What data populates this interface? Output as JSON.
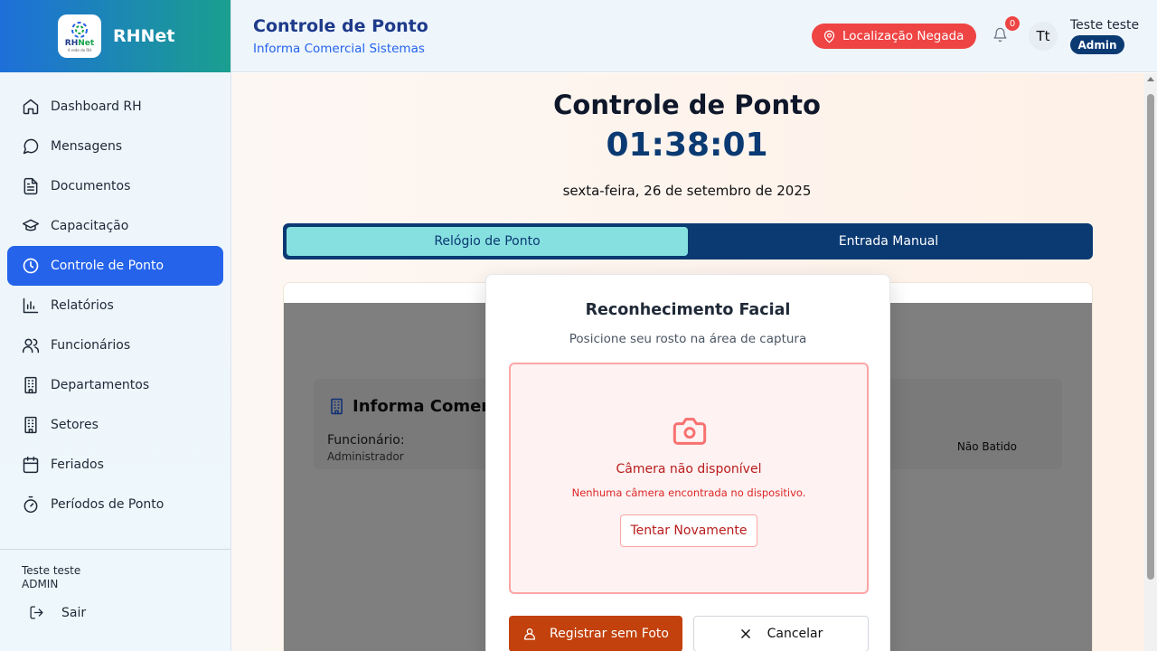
{
  "app": {
    "name": "RHNet",
    "logo_text_a": "RH",
    "logo_text_b": "Net",
    "logo_tagline": "A rede do RH"
  },
  "sidebar": {
    "items": [
      {
        "label": "Dashboard RH",
        "icon": "home-icon"
      },
      {
        "label": "Mensagens",
        "icon": "chat-icon"
      },
      {
        "label": "Documentos",
        "icon": "document-icon"
      },
      {
        "label": "Capacitação",
        "icon": "graduation-cap-icon"
      },
      {
        "label": "Controle de Ponto",
        "icon": "clock-icon",
        "active": true
      },
      {
        "label": "Relatórios",
        "icon": "bar-chart-icon"
      },
      {
        "label": "Funcionários",
        "icon": "users-icon"
      },
      {
        "label": "Departamentos",
        "icon": "building-icon"
      },
      {
        "label": "Setores",
        "icon": "building-icon"
      },
      {
        "label": "Feriados",
        "icon": "calendar-icon"
      },
      {
        "label": "Períodos de Ponto",
        "icon": "timer-icon"
      }
    ],
    "footer": {
      "user_name": "Teste teste",
      "user_role": "ADMIN",
      "logout_label": "Sair"
    }
  },
  "header": {
    "title": "Controle de Ponto",
    "subtitle": "Informa Comercial Sistemas",
    "location_badge": "Localização Negada",
    "notification_count": "0",
    "avatar_initials": "Tt",
    "user_name": "Teste teste",
    "user_role": "Admin"
  },
  "main": {
    "title": "Controle de Ponto",
    "time": "01:38:01",
    "date": "sexta-feira, 26 de setembro de 2025",
    "tabs": [
      {
        "label": "Relógio de Ponto",
        "active": true
      },
      {
        "label": "Entrada Manual",
        "active": false
      }
    ],
    "info_card": {
      "company": "Informa Comercial Sistemas",
      "employee_label": "Funcionário:",
      "employee_value": "Administrador",
      "status": "Não Batido"
    }
  },
  "modal": {
    "title": "Reconhecimento Facial",
    "subtitle": "Posicione seu rosto na área de captura",
    "error_title": "Câmera não disponível",
    "error_message": "Nenhuma câmera encontrada no dispositivo.",
    "retry_label": "Tentar Novamente",
    "register_no_photo_label": "Registrar sem Foto",
    "cancel_label": "Cancelar"
  },
  "colors": {
    "primary": "#2563eb",
    "navy": "#0b3a73",
    "danger": "#ef4444",
    "accent_orange": "#c2410c",
    "tab_active": "#86e0e0"
  }
}
